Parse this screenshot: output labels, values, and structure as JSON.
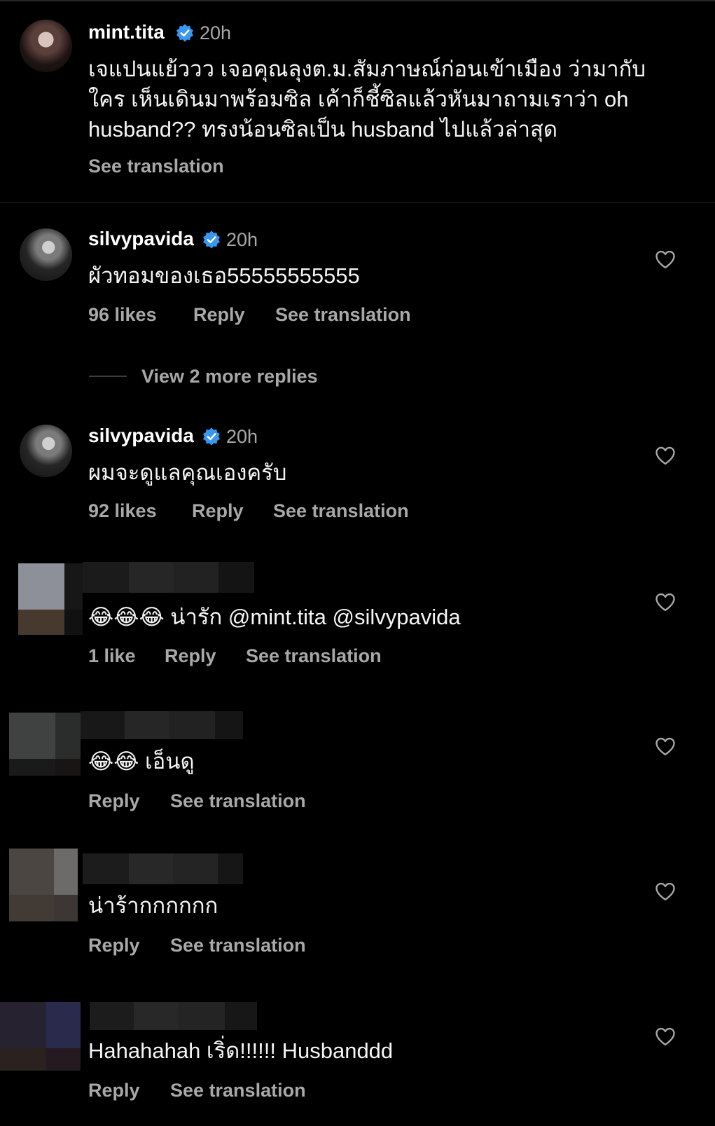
{
  "comments": [
    {
      "username": "mint.tita",
      "time": "20h",
      "text_lines": [
        "เจแปนแย้ววว เจอคุณลุงต.ม.สัมภาษณ์ก่อนเข้าเมือง ว่ามากับ",
        "ใคร เห็นเดินมาพร้อมซิล เค้าก็ชี้ซิลแล้วหันมาถามเราว่า oh",
        "husband?? ทรงน้อนซิลเป็น husband ไปแล้วล่าสุด"
      ],
      "see_translation": "See translation"
    },
    {
      "username": "silvypavida",
      "time": "20h",
      "text": "ผัวทอมของเธอ55555555555",
      "likes": "96 likes",
      "reply": "Reply",
      "see_translation": "See translation"
    },
    {
      "username": "silvypavida",
      "time": "20h",
      "text": "ผมจะดูแลคุณเองครับ",
      "likes": "92 likes",
      "reply": "Reply",
      "see_translation": "See translation"
    },
    {
      "text": "😂😂😂 น่ารัก @mint.tita @silvypavida",
      "likes": "1 like",
      "reply": "Reply",
      "see_translation": "See translation"
    },
    {
      "text": "😂😂 เอ็นดู",
      "reply": "Reply",
      "see_translation": "See translation"
    },
    {
      "text": "น่าร้ากกกกกก",
      "reply": "Reply",
      "see_translation": "See translation"
    },
    {
      "text": "Hahahahah เริ่ด!!!!!! Husbanddd",
      "reply": "Reply",
      "see_translation": "See translation"
    }
  ],
  "view_more_replies": "View 2 more replies",
  "colors": {
    "background": "#000000",
    "primary_text": "#f5f5f5",
    "secondary_text": "#a8a8a8",
    "verified": "#3897f0"
  },
  "icons": {
    "verified": "verified-badge-icon",
    "like": "heart-outline-icon"
  }
}
